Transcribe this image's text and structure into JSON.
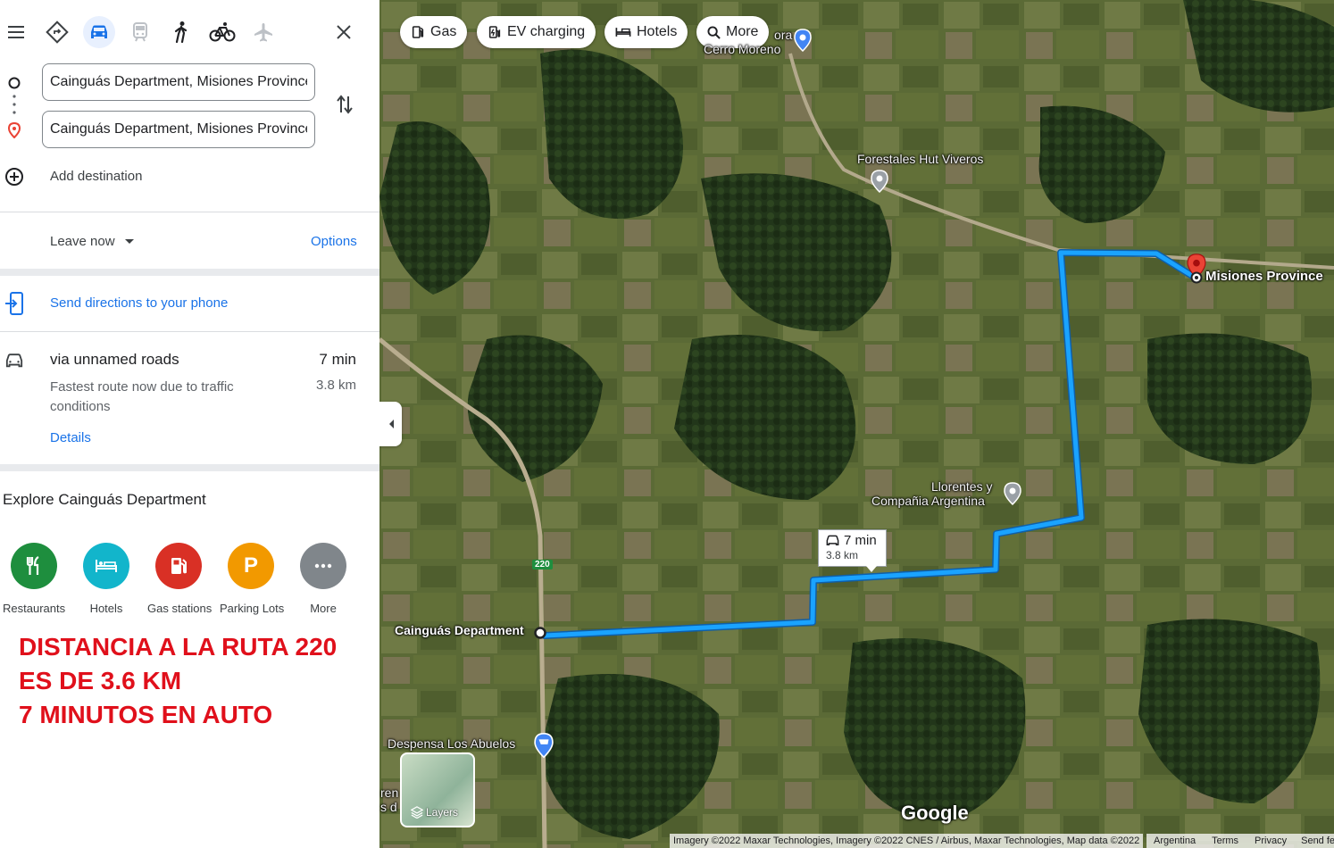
{
  "modes": {
    "best": "best-route-icon",
    "driving": "car-icon",
    "transit": "train-icon",
    "walking": "walk-icon",
    "cycling": "bike-icon",
    "flights": "plane-icon"
  },
  "inputs": {
    "origin_value": "Cainguás Department, Misiones Province",
    "destination_value": "Cainguás Department, Misiones Province",
    "add_destination": "Add destination"
  },
  "options_row": {
    "leave_now": "Leave now",
    "options": "Options"
  },
  "send_directions": "Send directions to your phone",
  "route": {
    "via": "via unnamed roads",
    "time": "7 min",
    "note": "Fastest route now due to traffic conditions",
    "distance": "3.8 km",
    "details": "Details"
  },
  "explore": {
    "title": "Explore Cainguás Department",
    "items": [
      {
        "label": "Restaurants",
        "color": "#1e8e3e",
        "icon": "fork-knife-icon"
      },
      {
        "label": "Hotels",
        "color": "#12b5cb",
        "icon": "bed-icon"
      },
      {
        "label": "Gas stations",
        "color": "#d93025",
        "icon": "fuel-icon"
      },
      {
        "label": "Parking Lots",
        "color": "#f29900",
        "icon": "parking-icon"
      },
      {
        "label": "More",
        "color": "#80868b",
        "icon": "more-dots-icon"
      }
    ]
  },
  "annotation": {
    "line1": "DISTANCIA A LA RUTA 220",
    "line2": "ES DE 3.6 KM",
    "line3": "7 MINUTOS EN AUTO"
  },
  "map": {
    "chips": {
      "gas": "Gas",
      "ev": "EV charging",
      "hotels": "Hotels",
      "more": "More"
    },
    "labels": {
      "cerro": "Cerro Moreno",
      "cerro_top": "ora",
      "forestales": "Forestales Hut Viveros",
      "misiones": "Misiones Province",
      "llorentes1": "Llorentes y",
      "llorentes2": "Compañia Argentina",
      "cainguas": "Cainguás Department",
      "despensa": "Despensa Los Abuelos",
      "ruta": "220",
      "edge1": "ren",
      "edge2": "s d"
    },
    "route_box": {
      "time": "7 min",
      "distance": "3.8 km"
    },
    "layers": "Layers",
    "google": "Google",
    "footer": {
      "imagery": "Imagery ©2022 Maxar Technologies, Imagery ©2022 CNES / Airbus, Maxar Technologies, Map data ©2022",
      "country": "Argentina",
      "terms": "Terms",
      "privacy": "Privacy",
      "feedback": "Send fe"
    },
    "colors": {
      "route": "#1aa3ff",
      "pin": "#ea4335"
    }
  }
}
